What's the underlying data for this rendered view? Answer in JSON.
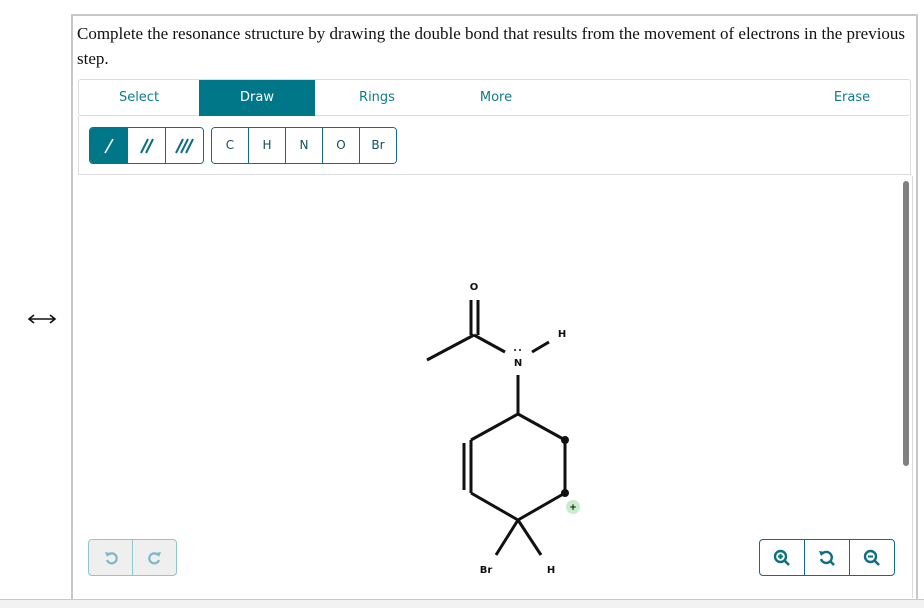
{
  "prompt": "Complete the resonance structure by drawing the double bond that results from the movement of electrons in the previous step.",
  "resonance_arrow": "resonance-double-arrow",
  "tabs": [
    {
      "label": "Select",
      "active": false
    },
    {
      "label": "Draw",
      "active": true
    },
    {
      "label": "Rings",
      "active": false
    },
    {
      "label": "More",
      "active": false
    },
    {
      "label": "Erase",
      "active": false
    }
  ],
  "bond_tools": [
    {
      "name": "single-bond",
      "active": true
    },
    {
      "name": "double-bond",
      "active": false
    },
    {
      "name": "triple-bond",
      "active": false
    }
  ],
  "atom_tools": [
    "C",
    "H",
    "N",
    "O",
    "Br"
  ],
  "molecule": {
    "atoms": {
      "O": "O",
      "N": "N",
      "H_on_N": "H",
      "Br": "Br",
      "H_ring": "H",
      "charge": "+"
    }
  },
  "history_buttons": [
    {
      "name": "undo",
      "enabled": false
    },
    {
      "name": "redo",
      "enabled": false
    }
  ],
  "zoom_buttons": [
    "zoom-in",
    "reset-zoom",
    "zoom-out"
  ],
  "colors": {
    "accent": "#007789",
    "accent_text": "#0e7c8c",
    "charge_bg": "#c9eccb",
    "disabled_bg": "#efefef"
  }
}
